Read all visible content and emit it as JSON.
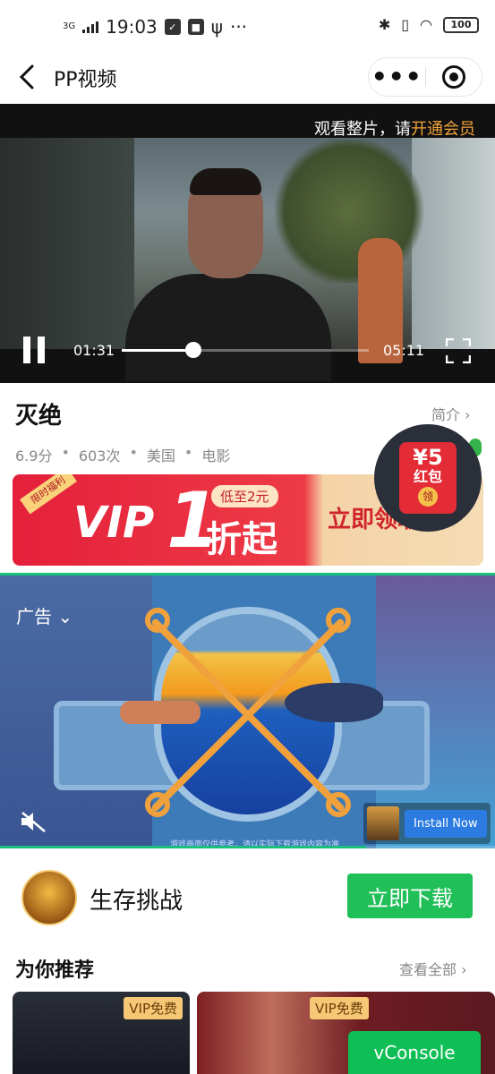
{
  "status_bar": {
    "network": "3G",
    "time": "19:03",
    "battery": "100"
  },
  "nav": {
    "back_icon": "chevron-left-icon",
    "title": "PP视频",
    "more_icon": "more-dots-icon",
    "close_icon": "target-close-icon"
  },
  "video": {
    "vip_hint_prefix": "观看整片，请",
    "vip_hint_link": "开通会员",
    "current_time": "01:31",
    "total_time": "05:11",
    "progress": 0.29
  },
  "info": {
    "title": "灭绝",
    "intro_label": "简介",
    "score": "6.9分",
    "plays": "603次",
    "region": "美国",
    "category": "电影"
  },
  "redpack": {
    "amount": "¥5",
    "label": "红包",
    "get": "领"
  },
  "vip_banner": {
    "tag": "限时福利",
    "vip": "VIP",
    "one": "1",
    "low_price": "低至2元",
    "zhe": "折起",
    "cta": "立即领取"
  },
  "ad": {
    "label": "广告",
    "install": "Install Now",
    "disclaimer": "游戏画面仅供参考，请以实际下载游戏内容为准",
    "progress": 0.74
  },
  "app_row": {
    "name": "生存挑战",
    "download": "立即下载"
  },
  "recommend": {
    "title": "为你推荐",
    "view_all": "查看全部",
    "cards": [
      {
        "badge": "VIP免费"
      },
      {
        "badge": "VIP免费"
      }
    ]
  },
  "vconsole": "vConsole",
  "colors": {
    "accent_green": "#20bf58",
    "vip_gold": "#f2a33a",
    "banner_red": "#e4203b"
  }
}
